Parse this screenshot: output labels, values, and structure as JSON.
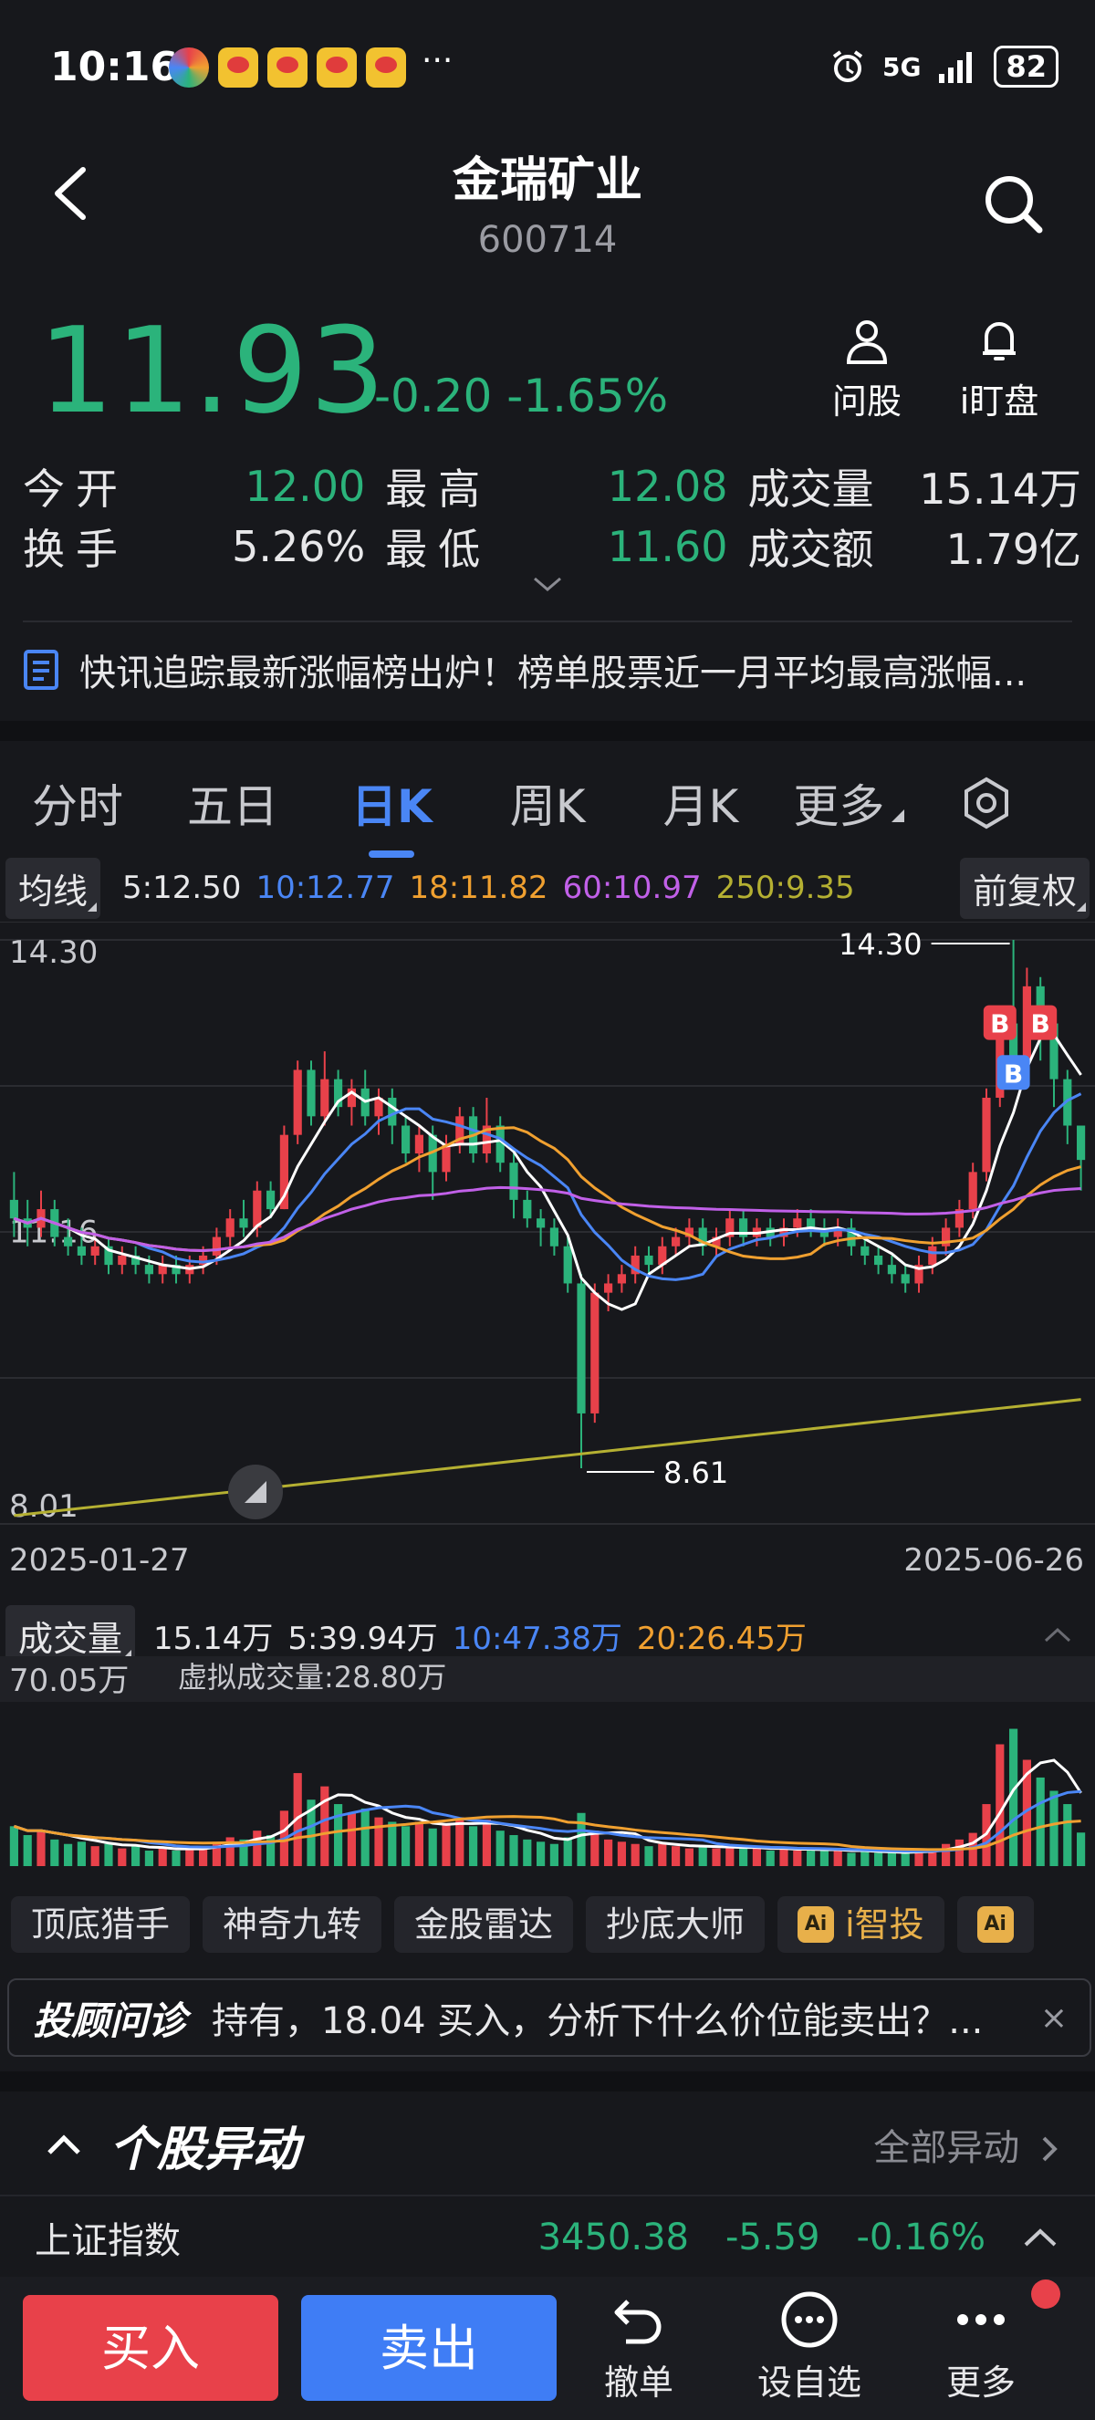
{
  "status_bar": {
    "time": "10:16",
    "more": "···",
    "network": "5G",
    "battery": "82"
  },
  "header": {
    "title": "金瑞矿业",
    "code": "600714"
  },
  "quote": {
    "price": "11.93",
    "change": "-0.20",
    "change_pct": "-1.65%"
  },
  "actions": {
    "ask": "问股",
    "watch": "i盯盘"
  },
  "stats": [
    {
      "label": "今开",
      "value": "12.00",
      "label2": "最高",
      "value2": "12.08",
      "label3": "成交量",
      "value3": "15.14万"
    },
    {
      "label": "换手",
      "value": "5.26%",
      "label2": "最低",
      "value2": "11.60",
      "label3": "成交额",
      "value3": "1.79亿"
    }
  ],
  "news": "快讯追踪最新涨幅榜出炉！榜单股票近一月平均最高涨幅...",
  "tabs": [
    "分时",
    "五日",
    "日K",
    "周K",
    "月K",
    "更多"
  ],
  "active_tab": "日K",
  "ma": {
    "selector": "均线",
    "ma5": "5:12.50",
    "ma10": "10:12.77",
    "ma18": "18:11.82",
    "ma60": "60:10.97",
    "ma250": "250:9.35",
    "adjust": "前复权"
  },
  "colors": {
    "up": "#e8414a",
    "down": "#2bb37b",
    "ma5": "#ffffff",
    "ma10": "#4a86f5",
    "ma18": "#f0a030",
    "ma60": "#c160e8",
    "ma250": "#b5b032"
  },
  "chart_data": [
    {
      "type": "candlestick",
      "y_labels": [
        "14.30",
        "11.16",
        "8.01"
      ],
      "ylim": [
        8.01,
        14.3
      ],
      "x_start": "2025-01-27",
      "x_end": "2025-06-26",
      "max_label": "14.30",
      "min_label": "8.61",
      "candles": [
        [
          11.5,
          11.3,
          11.8,
          11.1
        ],
        [
          11.3,
          11.2,
          11.5,
          11.0
        ],
        [
          11.2,
          11.4,
          11.6,
          11.1
        ],
        [
          11.4,
          11.1,
          11.5,
          11.0
        ],
        [
          11.1,
          11.0,
          11.3,
          10.9
        ],
        [
          11.0,
          10.9,
          11.2,
          10.8
        ],
        [
          10.9,
          11.0,
          11.1,
          10.8
        ],
        [
          11.0,
          10.8,
          11.1,
          10.7
        ],
        [
          10.8,
          10.9,
          11.0,
          10.7
        ],
        [
          10.9,
          10.8,
          11.0,
          10.7
        ],
        [
          10.8,
          10.7,
          10.9,
          10.6
        ],
        [
          10.7,
          10.8,
          10.9,
          10.6
        ],
        [
          10.8,
          10.7,
          10.9,
          10.6
        ],
        [
          10.7,
          10.8,
          10.9,
          10.6
        ],
        [
          10.8,
          10.9,
          11.0,
          10.7
        ],
        [
          10.9,
          11.1,
          11.2,
          10.8
        ],
        [
          11.1,
          11.3,
          11.4,
          11.0
        ],
        [
          11.3,
          11.2,
          11.5,
          11.1
        ],
        [
          11.2,
          11.6,
          11.7,
          11.1
        ],
        [
          11.6,
          11.4,
          11.7,
          11.3
        ],
        [
          11.4,
          12.2,
          12.3,
          11.4
        ],
        [
          12.2,
          12.9,
          13.0,
          12.1
        ],
        [
          12.9,
          12.4,
          13.0,
          12.3
        ],
        [
          12.4,
          12.8,
          13.1,
          12.3
        ],
        [
          12.8,
          12.5,
          12.9,
          12.4
        ],
        [
          12.5,
          12.7,
          12.8,
          12.3
        ],
        [
          12.7,
          12.4,
          12.9,
          12.3
        ],
        [
          12.4,
          12.6,
          12.7,
          12.2
        ],
        [
          12.6,
          12.3,
          12.7,
          12.1
        ],
        [
          12.3,
          12.0,
          12.4,
          11.9
        ],
        [
          12.0,
          12.2,
          12.3,
          11.8
        ],
        [
          12.2,
          11.8,
          12.3,
          11.5
        ],
        [
          11.8,
          12.1,
          12.2,
          11.7
        ],
        [
          12.1,
          12.4,
          12.5,
          12.0
        ],
        [
          12.4,
          12.0,
          12.5,
          11.9
        ],
        [
          12.0,
          12.3,
          12.6,
          11.9
        ],
        [
          12.3,
          11.9,
          12.4,
          11.8
        ],
        [
          11.9,
          11.5,
          12.0,
          11.3
        ],
        [
          11.5,
          11.3,
          11.6,
          11.2
        ],
        [
          11.3,
          11.2,
          11.4,
          11.0
        ],
        [
          11.2,
          11.0,
          11.3,
          10.9
        ],
        [
          11.0,
          10.6,
          11.1,
          10.5
        ],
        [
          10.6,
          9.2,
          10.7,
          8.61
        ],
        [
          9.2,
          10.5,
          10.6,
          9.1
        ],
        [
          10.5,
          10.6,
          10.7,
          10.3
        ],
        [
          10.6,
          10.7,
          10.8,
          10.5
        ],
        [
          10.7,
          10.9,
          11.0,
          10.6
        ],
        [
          10.9,
          10.8,
          11.0,
          10.7
        ],
        [
          10.8,
          11.0,
          11.1,
          10.7
        ],
        [
          11.0,
          11.1,
          11.2,
          10.9
        ],
        [
          11.1,
          11.2,
          11.3,
          11.0
        ],
        [
          11.2,
          11.0,
          11.3,
          10.9
        ],
        [
          11.0,
          11.1,
          11.2,
          10.9
        ],
        [
          11.1,
          11.3,
          11.4,
          11.0
        ],
        [
          11.3,
          11.1,
          11.4,
          11.0
        ],
        [
          11.1,
          11.2,
          11.3,
          11.0
        ],
        [
          11.2,
          11.1,
          11.3,
          11.0
        ],
        [
          11.1,
          11.2,
          11.3,
          11.0
        ],
        [
          11.2,
          11.3,
          11.4,
          11.1
        ],
        [
          11.3,
          11.2,
          11.4,
          11.1
        ],
        [
          11.2,
          11.1,
          11.3,
          11.0
        ],
        [
          11.1,
          11.2,
          11.3,
          11.0
        ],
        [
          11.2,
          11.0,
          11.3,
          10.9
        ],
        [
          11.0,
          10.9,
          11.1,
          10.8
        ],
        [
          10.9,
          10.8,
          11.0,
          10.7
        ],
        [
          10.8,
          10.7,
          10.9,
          10.6
        ],
        [
          10.7,
          10.6,
          10.8,
          10.5
        ],
        [
          10.6,
          10.8,
          10.9,
          10.5
        ],
        [
          10.8,
          11.0,
          11.1,
          10.7
        ],
        [
          11.0,
          11.2,
          11.3,
          10.9
        ],
        [
          11.2,
          11.4,
          11.5,
          11.1
        ],
        [
          11.4,
          11.8,
          11.9,
          11.3
        ],
        [
          11.8,
          12.6,
          12.7,
          11.7
        ],
        [
          12.6,
          13.4,
          13.5,
          12.5
        ],
        [
          13.4,
          13.0,
          14.3,
          12.9
        ],
        [
          13.0,
          13.8,
          14.0,
          12.8
        ],
        [
          13.8,
          13.4,
          13.9,
          13.0
        ],
        [
          13.4,
          12.8,
          13.5,
          12.5
        ],
        [
          12.8,
          12.3,
          12.9,
          12.1
        ],
        [
          12.3,
          11.93,
          12.08,
          11.6
        ]
      ],
      "markers": [
        "B",
        "B",
        "B"
      ]
    },
    {
      "type": "bar",
      "y_labels": [
        "70.05万"
      ],
      "ylim": [
        0,
        70.05
      ],
      "values": [
        18,
        14,
        16,
        12,
        10,
        11,
        9,
        10,
        8,
        9,
        7,
        8,
        7,
        8,
        9,
        11,
        13,
        12,
        16,
        14,
        25,
        42,
        30,
        36,
        28,
        24,
        26,
        22,
        20,
        18,
        20,
        17,
        19,
        22,
        18,
        21,
        16,
        14,
        12,
        11,
        10,
        13,
        24,
        16,
        12,
        11,
        10,
        9,
        10,
        9,
        8,
        9,
        8,
        9,
        8,
        8,
        7,
        8,
        7,
        8,
        7,
        7,
        6,
        7,
        6,
        6,
        6,
        7,
        8,
        10,
        12,
        15,
        28,
        55,
        62,
        48,
        40,
        34,
        28,
        15.14
      ]
    }
  ],
  "volume": {
    "selector": "成交量",
    "current": "15.14万",
    "ma5": "5:39.94万",
    "ma10": "10:47.38万",
    "ma20": "20:26.45万",
    "virtual": "虚拟成交量:28.80万"
  },
  "tools": [
    "顶底猎手",
    "神奇九转",
    "金股雷达",
    "抄底大师",
    "i智投"
  ],
  "ai_badge": "Ai",
  "advisor": {
    "brand": "投顾问诊",
    "text": "持有，18.04 买入，分析下什么价位能卖出？...",
    "close": "×"
  },
  "unusual": {
    "title": "个股异动",
    "all": "全部异动"
  },
  "index": {
    "name": "上证指数",
    "value": "3450.38",
    "change": "-5.59",
    "pct": "-0.16%"
  },
  "bottom": {
    "buy": "买入",
    "sell": "卖出",
    "cancel": "撤单",
    "add": "设自选",
    "more": "更多"
  }
}
